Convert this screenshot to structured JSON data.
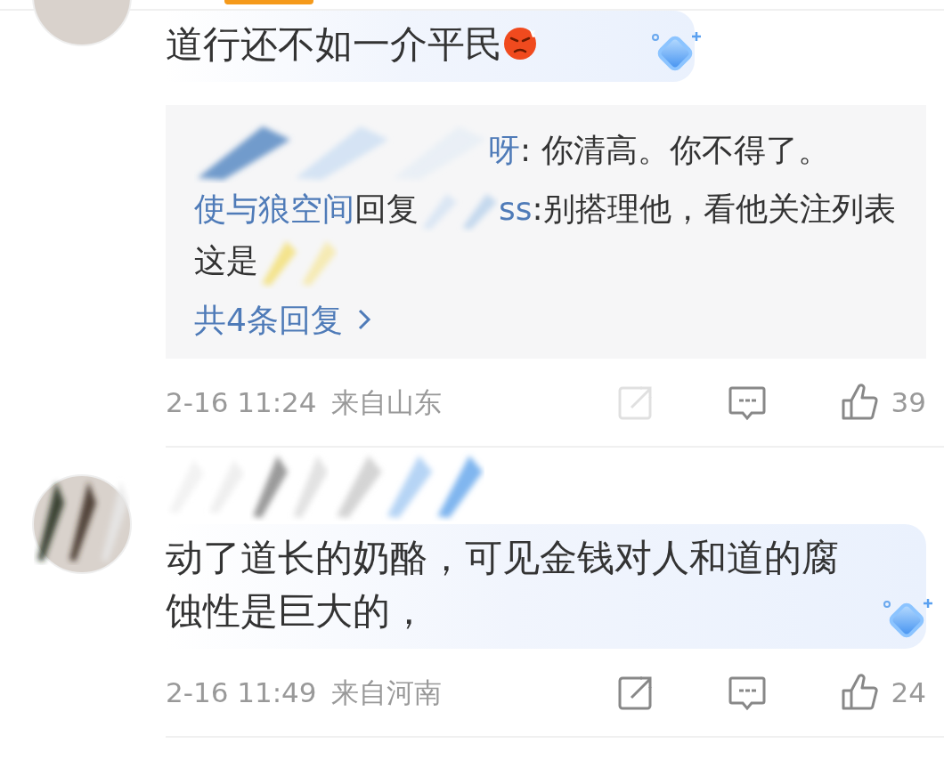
{
  "comments": [
    {
      "text": "道行还不如一介平民",
      "trailing_emoji": true,
      "author_hidden": false,
      "replies": [
        {
          "name": "呀",
          "text": ": 你清高。你不得了。",
          "hidden_prefix": true,
          "hidden_tail": false
        },
        {
          "name": "使与狼空间",
          "action": "回复",
          "mention": "ss",
          "text": ":别搭理他，看他关注列表这是",
          "hidden_prefix": false,
          "hidden_tail": true
        }
      ],
      "reply_count": "共4条回复",
      "time": "2-16 11:24",
      "location": "来自山东",
      "likes": "39"
    },
    {
      "text": "动了道长的奶酪，可见金钱对人和道的腐蚀性是巨大的，",
      "trailing_emoji": false,
      "author_hidden": true,
      "time": "2-16 11:49",
      "location": "来自河南",
      "likes": "24"
    }
  ]
}
